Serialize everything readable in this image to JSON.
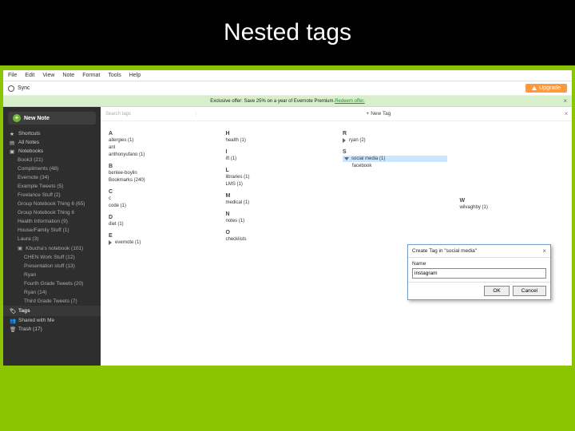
{
  "slide_title": "Nested tags",
  "menu": {
    "file": "File",
    "edit": "Edit",
    "view": "View",
    "note": "Note",
    "format": "Format",
    "tools": "Tools",
    "help": "Help"
  },
  "toolbar": {
    "sync": "Sync",
    "upgrade": "Upgrade"
  },
  "banner": {
    "text": "Exclusive offer: Save 25% on a year of Evernote Premium. ",
    "link": "Redeem offer."
  },
  "sidebar": {
    "new_note": "New Note",
    "shortcuts": "Shortcuts",
    "all_notes": "All Notes",
    "notebooks": "Notebooks",
    "notebooks_items": [
      "Book3  (21)",
      "Compliments (48)",
      "Evernote  (34)",
      "Example Tweets  (5)",
      "Freelance Stuff  (2)",
      "Group Notebook Thing 6  (65)",
      "Group Notebook Thing 6",
      "Health Information  (9)",
      "House/Family Stuff (1)",
      "Laura  (3)"
    ],
    "notebook_stack": "Kbucha's notebook  (101)",
    "stack_children": [
      "CHEN Work Stuff  (12)",
      "Presentation stuff  (13)",
      "Ryan"
    ],
    "stack_sub": [
      "Fourth Grade Tweets (20)",
      "Ryan  (14)",
      "Third Grade Tweets  (7)"
    ],
    "tags": "Tags",
    "shared": "Shared with Me",
    "trash": "Trash  (17)"
  },
  "tags_ui": {
    "search_placeholder": "Search tags",
    "new_tag": "+ New Tag"
  },
  "columns": {
    "A": {
      "letter": "A",
      "items": [
        "allergies  (1)",
        "ant",
        "anthonyufano (1)"
      ]
    },
    "B": {
      "letter": "B",
      "items": [
        "benlee-boylin",
        "Bookmarks  (240)"
      ]
    },
    "C": {
      "letter": "C",
      "items": [
        "c",
        "code  (1)"
      ]
    },
    "D": {
      "letter": "D",
      "items": [
        "diet (1)"
      ]
    },
    "E": {
      "letter": "E",
      "items": [
        "evernote (1)"
      ]
    },
    "H": {
      "letter": "H",
      "items": [
        "health (1)"
      ]
    },
    "I": {
      "letter": "I",
      "items": [
        "ift (1)"
      ]
    },
    "L": {
      "letter": "L",
      "items": [
        "libraries  (1)",
        "LMS (1)"
      ]
    },
    "M": {
      "letter": "M",
      "items": [
        "medical (1)"
      ]
    },
    "N": {
      "letter": "N",
      "items": [
        "notes (1)"
      ]
    },
    "O": {
      "letter": "O",
      "items": [
        "checklists"
      ]
    },
    "R": {
      "letter": "R",
      "items": [
        "ryan (2)"
      ]
    },
    "S": {
      "letter": "S",
      "items": [
        "social media  (1)",
        "facebook"
      ]
    },
    "W": {
      "letter": "W",
      "items": [
        "wilvaghby (1)"
      ]
    }
  },
  "modal": {
    "title": "Create Tag in \"social media\"",
    "label": "Name",
    "value": "instagram",
    "ok": "OK",
    "cancel": "Cancel"
  }
}
